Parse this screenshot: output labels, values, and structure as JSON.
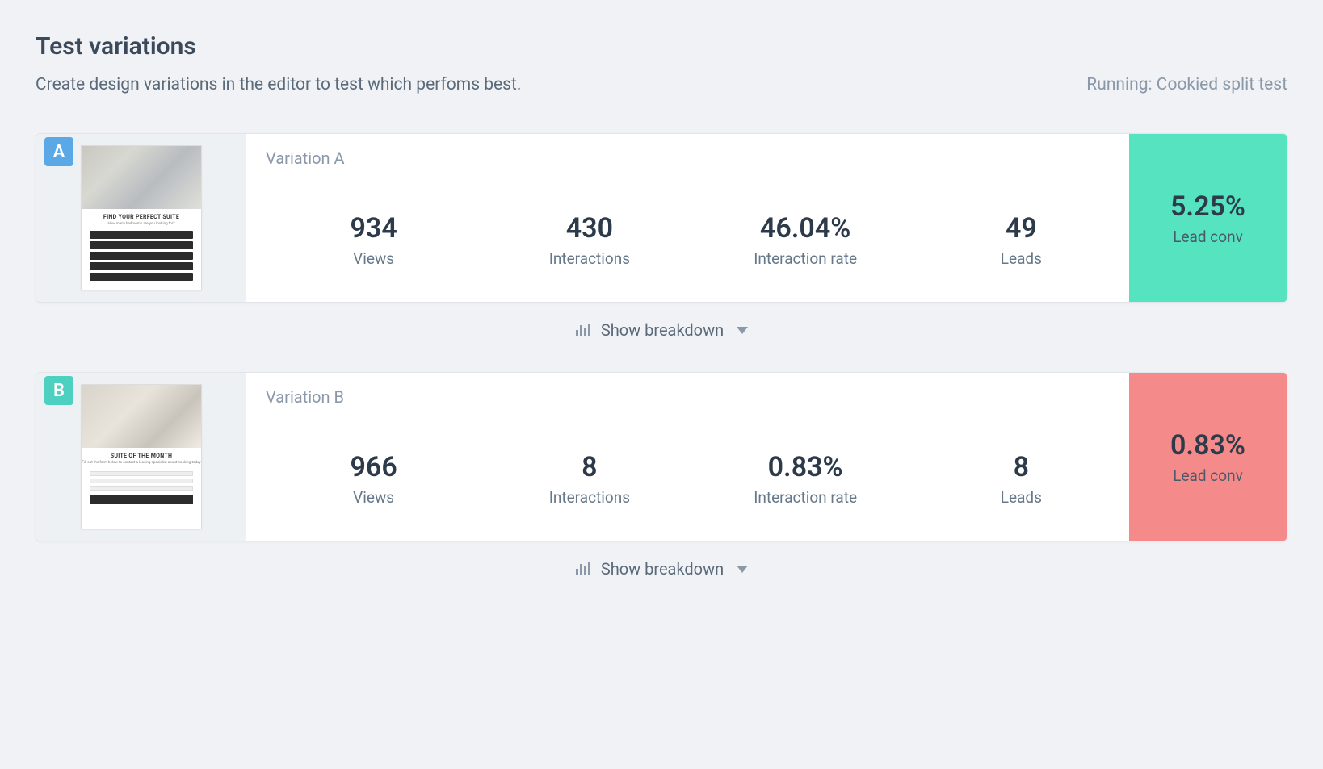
{
  "header": {
    "title": "Test variations",
    "subtitle": "Create design variations in the editor to test which perfoms best.",
    "status": "Running: Cookied split test"
  },
  "metric_labels": {
    "views": "Views",
    "interactions": "Interactions",
    "interaction_rate": "Interaction rate",
    "leads": "Leads",
    "lead_conv": "Lead conv"
  },
  "breakdown_label": "Show breakdown",
  "variations": {
    "a": {
      "badge": "A",
      "name": "Variation A",
      "thumb_title": "FIND YOUR PERFECT SUITE",
      "views": "934",
      "interactions": "430",
      "interaction_rate": "46.04%",
      "leads": "49",
      "lead_conv": "5.25%"
    },
    "b": {
      "badge": "B",
      "name": "Variation B",
      "thumb_title": "SUITE OF THE MONTH",
      "views": "966",
      "interactions": "8",
      "interaction_rate": "0.83%",
      "leads": "8",
      "lead_conv": "0.83%"
    }
  }
}
